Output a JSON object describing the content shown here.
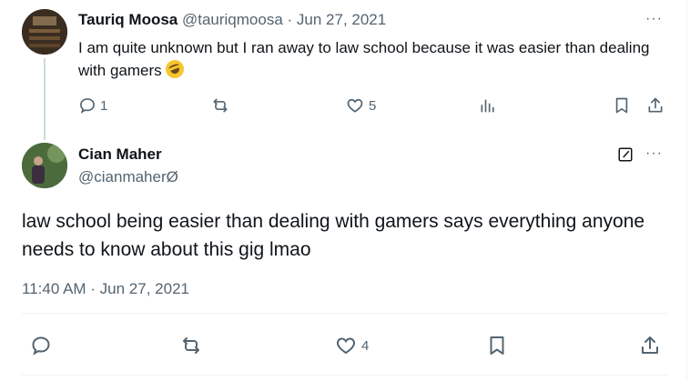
{
  "parent_tweet": {
    "display_name": "Tauriq Moosa",
    "meta": "@tauriqmoosa · Jun 27, 2021",
    "text": "I am quite unknown but I ran away to law school because it was easier than dealing with gamers",
    "emoji_icon": "rolling-on-floor-laughing-emoji",
    "counts": {
      "replies": "1",
      "retweets": "",
      "likes": "5"
    }
  },
  "main_tweet": {
    "display_name": "Cian Maher",
    "handle": "@cianmaherØ",
    "text": "law school being easier than dealing with gamers says everything anyone needs to know about this gig lmao",
    "timestamp": "11:40 AM · Jun 27, 2021",
    "counts": {
      "replies": "",
      "retweets": "",
      "likes": "4"
    }
  },
  "more_label": "···",
  "colors": {
    "text": "#0f1419",
    "muted": "#536471",
    "divider": "#eff3f4",
    "thread_line": "#cfd9de"
  }
}
